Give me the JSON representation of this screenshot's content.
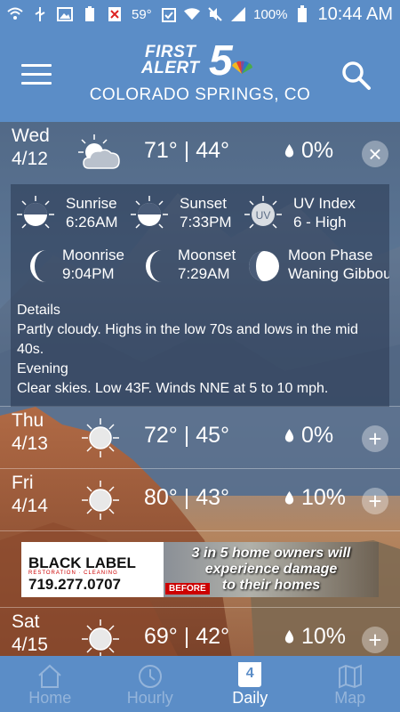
{
  "status_bar": {
    "temperature": "59°",
    "battery": "100%",
    "time": "10:44 AM",
    "icons": [
      "wifi-icon",
      "usb-icon",
      "image-icon",
      "battery-saver-icon",
      "blocked-icon",
      "clipboard-check-icon",
      "wifi-signal-icon",
      "mute-icon",
      "cell-signal-icon",
      "battery-icon"
    ]
  },
  "header": {
    "logo_line1": "FIRST",
    "logo_line2": "ALERT",
    "logo_number": "5",
    "location": "COLORADO SPRINGS, CO",
    "menu_icon": "hamburger-menu-icon",
    "search_icon": "search-icon"
  },
  "days": [
    {
      "name": "Wed",
      "date": "4/12",
      "icon": "partly-cloudy-icon",
      "temps": "71° | 44°",
      "precip": "0%",
      "expanded": true,
      "toggle": "×",
      "details": {
        "sunrise_label": "Sunrise",
        "sunrise": "6:26AM",
        "sunset_label": "Sunset",
        "sunset": "7:33PM",
        "uv_label": "UV Index",
        "uv": "6 - High",
        "uv_badge": "UV",
        "moonrise_label": "Moonrise",
        "moonrise": "9:04PM",
        "moonset_label": "Moonset",
        "moonset": "7:29AM",
        "moonphase_label": "Moon Phase",
        "moonphase": "Waning Gibbous",
        "details_heading": "Details",
        "details_text": "Partly cloudy. Highs in the low 70s and lows in the mid 40s.",
        "evening_heading": "Evening",
        "evening_text": "Clear skies. Low 43F. Winds NNE at 5 to 10 mph."
      }
    },
    {
      "name": "Thu",
      "date": "4/13",
      "icon": "sunny-icon",
      "temps": "72° | 45°",
      "precip": "0%",
      "toggle": "+"
    },
    {
      "name": "Fri",
      "date": "4/14",
      "icon": "sunny-icon",
      "temps": "80° | 43°",
      "precip": "10%",
      "toggle": "+"
    },
    {
      "name": "Sat",
      "date": "4/15",
      "icon": "sunny-icon",
      "temps": "69° | 42°",
      "precip": "10%",
      "toggle": "+"
    }
  ],
  "ad": {
    "brand": "BLACK LABEL",
    "tagline": "RESTORATION · CLEANING",
    "phone": "719.277.0707",
    "promo_line1": "3 in 5 home owners will",
    "promo_line2": "experience damage",
    "promo_line3": "to their homes",
    "before_label": "BEFORE"
  },
  "bottom_nav": [
    {
      "label": "Home",
      "icon": "home-icon",
      "active": false
    },
    {
      "label": "Hourly",
      "icon": "clock-icon",
      "active": false
    },
    {
      "label": "Daily",
      "icon": "calendar-icon",
      "calendar_day": "4",
      "active": true
    },
    {
      "label": "Map",
      "icon": "map-icon",
      "active": false
    }
  ],
  "colors": {
    "header": "#5b8dc7",
    "accent": "#ffffff"
  }
}
